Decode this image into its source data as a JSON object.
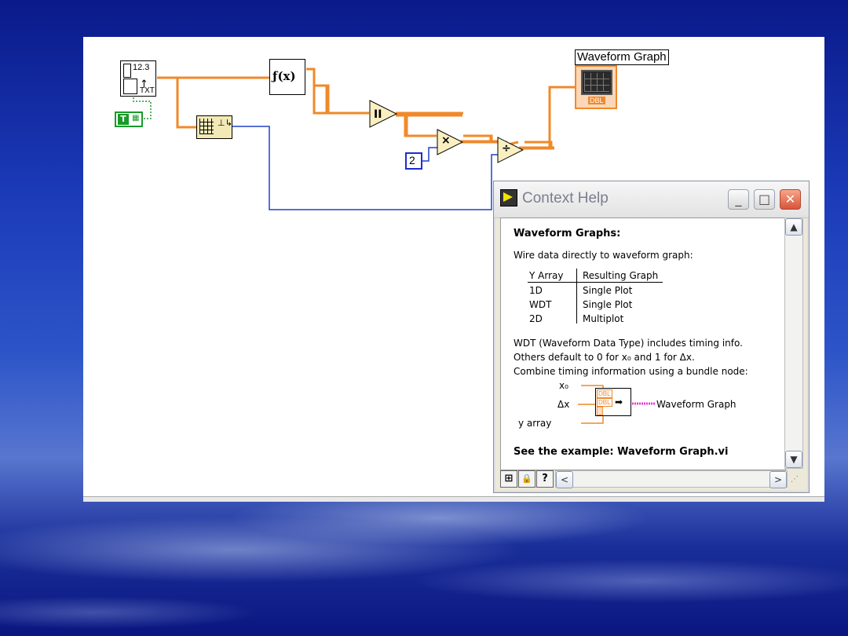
{
  "diagram": {
    "graph_label": "Waveform Graph",
    "read_node_value": "12.3",
    "read_node_sub": "TXT",
    "bool_const": "T",
    "formula_node": "ƒ(x)",
    "multiply_symbol": "×",
    "divide_symbol": "÷",
    "const_value": "2",
    "graph_terminal_tag": "DBL"
  },
  "help_window": {
    "title": "Context Help",
    "buttons": {
      "minimize": "_",
      "maximize": "□",
      "close": "✕"
    },
    "heading": "Waveform Graphs:",
    "intro": "Wire data directly to waveform graph:",
    "table": {
      "headers": [
        "Y Array",
        "Resulting Graph"
      ],
      "rows": [
        [
          "1D",
          "Single Plot"
        ],
        [
          "WDT",
          "Single Plot"
        ],
        [
          "2D",
          "Multiplot"
        ]
      ]
    },
    "notes": [
      "WDT (Waveform Data Type) includes timing info.",
      "Others default to 0 for x₀ and 1 for Δx.",
      "Combine timing information using a bundle node:"
    ],
    "bundle": {
      "inputs": [
        "x₀",
        "Δx",
        "y array"
      ],
      "tags": [
        "DBL",
        "DBL",
        "[]"
      ],
      "output": "Waveform Graph"
    },
    "example": "See the example: Waveform Graph.vi",
    "toolbar": {
      "btn1": "⊞",
      "btn2": "🔒",
      "btn3": "?",
      "left": "<",
      "right": ">"
    }
  }
}
